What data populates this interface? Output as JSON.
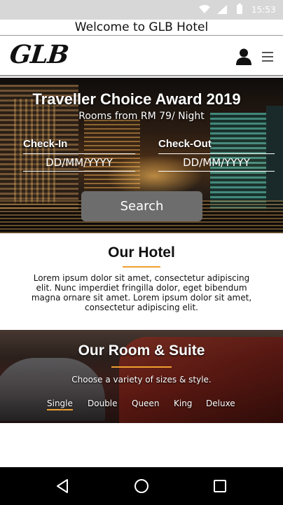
{
  "status_bar": {
    "time": "15:53",
    "icons": [
      "wifi-icon",
      "signal-icon",
      "battery-icon"
    ]
  },
  "welcome": {
    "text": "Welcome to GLB Hotel"
  },
  "header": {
    "logo_text": "GLB",
    "icons": [
      "user-icon",
      "menu-icon"
    ]
  },
  "hero": {
    "title": "Traveller Choice Award 2019",
    "subtitle": "Rooms from RM 79/ Night",
    "checkin_label": "Check-In",
    "checkin_placeholder": "DD/MM/YYYY",
    "checkout_label": "Check-Out",
    "checkout_placeholder": "DD/MM/YYYY",
    "search_label": "Search"
  },
  "our_hotel": {
    "title": "Our Hotel",
    "text": "Lorem ipsum dolor sit amet, consectetur adipiscing elit. Nunc imperdiet fringilla dolor, eget bibendum magna ornare sit amet. Lorem ipsum dolor sit amet, consectetur adipiscing elit."
  },
  "rooms": {
    "title": "Our Room & Suite",
    "subtitle": "Choose a variety of sizes & style.",
    "tabs": [
      {
        "label": "Single",
        "active": true
      },
      {
        "label": "Double",
        "active": false
      },
      {
        "label": "Queen",
        "active": false
      },
      {
        "label": "King",
        "active": false
      },
      {
        "label": "Deluxe",
        "active": false
      }
    ]
  },
  "system_nav": {
    "buttons": [
      "back-icon",
      "home-icon",
      "recents-icon"
    ]
  },
  "colors": {
    "accent": "#f0a030",
    "button": "#6d6d6d",
    "status_bar": "#d7d7d7",
    "nav_bar": "#000000"
  }
}
